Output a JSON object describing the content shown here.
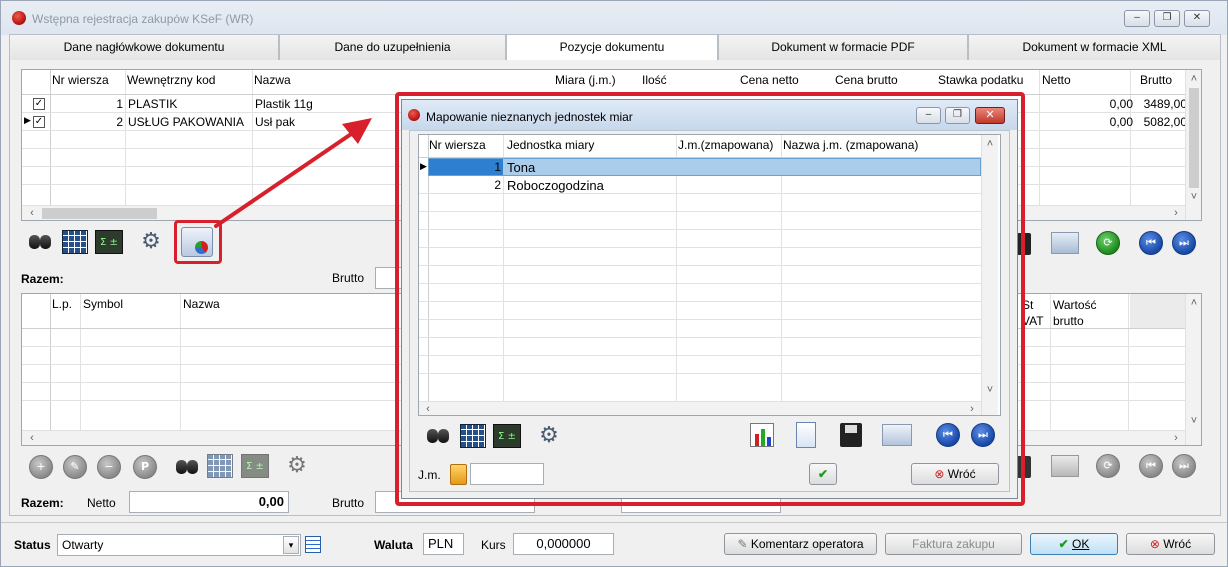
{
  "window": {
    "title": "Wstępna rejestracja zakupów KSeF (WR)",
    "controls": [
      "‒",
      "❐",
      "✕"
    ]
  },
  "tabs": [
    {
      "label": "Dane nagłówkowe dokumentu",
      "active": false
    },
    {
      "label": "Dane do uzupełnienia",
      "active": false
    },
    {
      "label": "Pozycje dokumentu",
      "active": true
    },
    {
      "label": "Dokument w formacie PDF",
      "active": false
    },
    {
      "label": "Dokument w formacie XML",
      "active": false
    }
  ],
  "positions_grid": {
    "columns": [
      "Nr wiersza",
      "Wewnętrzny kod",
      "Nazwa",
      "Miara (j.m.)",
      "Ilość",
      "Cena netto",
      "Cena brutto",
      "Stawka podatku",
      "Netto",
      "Brutto"
    ],
    "rows": [
      {
        "checked": true,
        "nr": "1",
        "kod": "PLASTIK",
        "nazwa": "Plastik 11g",
        "netto": "0,00",
        "brutto": "3489,00",
        "current": false
      },
      {
        "checked": true,
        "nr": "2",
        "kod": "USŁUG PAKOWANIA",
        "nazwa": "Usł pak",
        "netto": "0,00",
        "brutto": "5082,00",
        "current": true
      }
    ]
  },
  "toolbar_icons": [
    "binoculars-icon",
    "calculator-table-icon",
    "sigma-icon",
    "gears-icon",
    "mapping-icon"
  ],
  "summary1": {
    "label": "Razem:",
    "brutto_label": "Brutto"
  },
  "items_grid": {
    "columns": [
      "L.p.",
      "Symbol",
      "Nazwa",
      "St VAT",
      "Wartość brutto"
    ]
  },
  "bottom_buttons": {
    "p_label": "P"
  },
  "summary2": {
    "label": "Razem:",
    "netto_label": "Netto",
    "netto_value": "0,00",
    "brutto_label": "Brutto"
  },
  "statusbar": {
    "status_label": "Status",
    "status_value": "Otwarty",
    "waluta_label": "Waluta",
    "waluta_value": "PLN",
    "kurs_label": "Kurs",
    "kurs_value": "0,000000",
    "komentarz_btn": "Komentarz operatora",
    "faktura_btn": "Faktura zakupu",
    "ok_btn": "OK",
    "wroc_btn": "Wróć"
  },
  "dialog": {
    "title": "Mapowanie nieznanych jednostek miar",
    "columns": [
      "Nr wiersza",
      "Jednostka miary",
      "J.m.(zmapowana)",
      "Nazwa j.m. (zmapowana)"
    ],
    "rows": [
      {
        "nr": "1",
        "jm": "Tona",
        "selected": true
      },
      {
        "nr": "2",
        "jm": "Roboczogodzina",
        "selected": false
      }
    ],
    "jm_label": "J.m.",
    "jm_value": "",
    "wroc_btn": "Wróć"
  },
  "colors": {
    "highlight": "#d8202c",
    "selection": "#a9cdea",
    "ok_button": "#bfe0f6"
  }
}
